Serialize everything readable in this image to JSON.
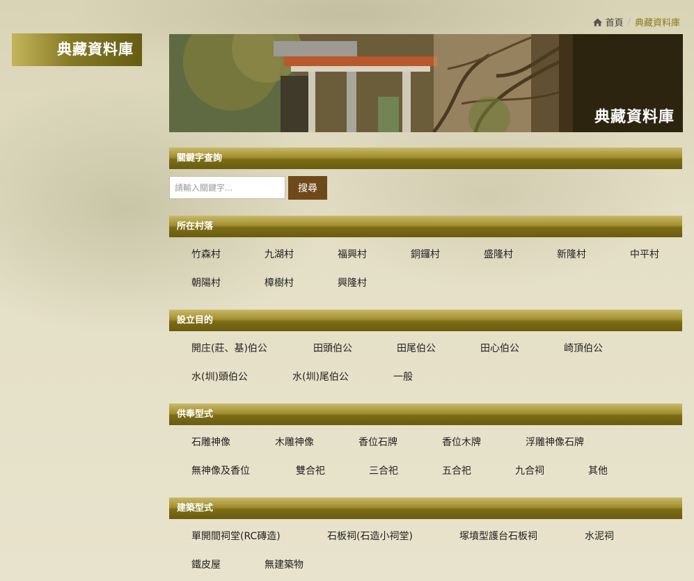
{
  "breadcrumb": {
    "home_label": "首頁",
    "current_label": "典藏資料庫"
  },
  "sidebar": {
    "title": "典藏資料庫"
  },
  "banner": {
    "title": "典藏資料庫"
  },
  "search": {
    "section_title": "關鍵字查詢",
    "placeholder": "請輸入關鍵字...",
    "value": "",
    "button_label": "搜尋"
  },
  "villages": {
    "section_title": "所在村落",
    "items": [
      "竹森村",
      "九湖村",
      "福興村",
      "銅鑼村",
      "盛隆村",
      "新隆村",
      "中平村",
      "朝陽村",
      "樟樹村",
      "興隆村"
    ]
  },
  "purposes": {
    "section_title": "設立目的",
    "items": [
      "開庄(莊、基)伯公",
      "田頭伯公",
      "田尾伯公",
      "田心伯公",
      "崎頂伯公",
      "水(圳)頭伯公",
      "水(圳)尾伯公",
      "一般"
    ]
  },
  "worship_types": {
    "section_title": "供奉型式",
    "items": [
      "石雕神像",
      "木雕神像",
      "香位石牌",
      "香位木牌",
      "浮雕神像石牌",
      "無神像及香位",
      "雙合祀",
      "三合祀",
      "五合祀",
      "九合祠",
      "其他"
    ]
  },
  "building_types": {
    "section_title": "建築型式",
    "items": [
      "單開間祠堂(RC磚造)",
      "石板祠(石造小祠堂)",
      "塚墳型護台石板祠",
      "水泥祠",
      "鐵皮屋",
      "無建築物"
    ]
  },
  "colors": {
    "section_bar": "#8a7a20",
    "button": "#6e4a1a",
    "breadcrumb_current": "#8a7a1c",
    "background": "#e6e1c8"
  }
}
